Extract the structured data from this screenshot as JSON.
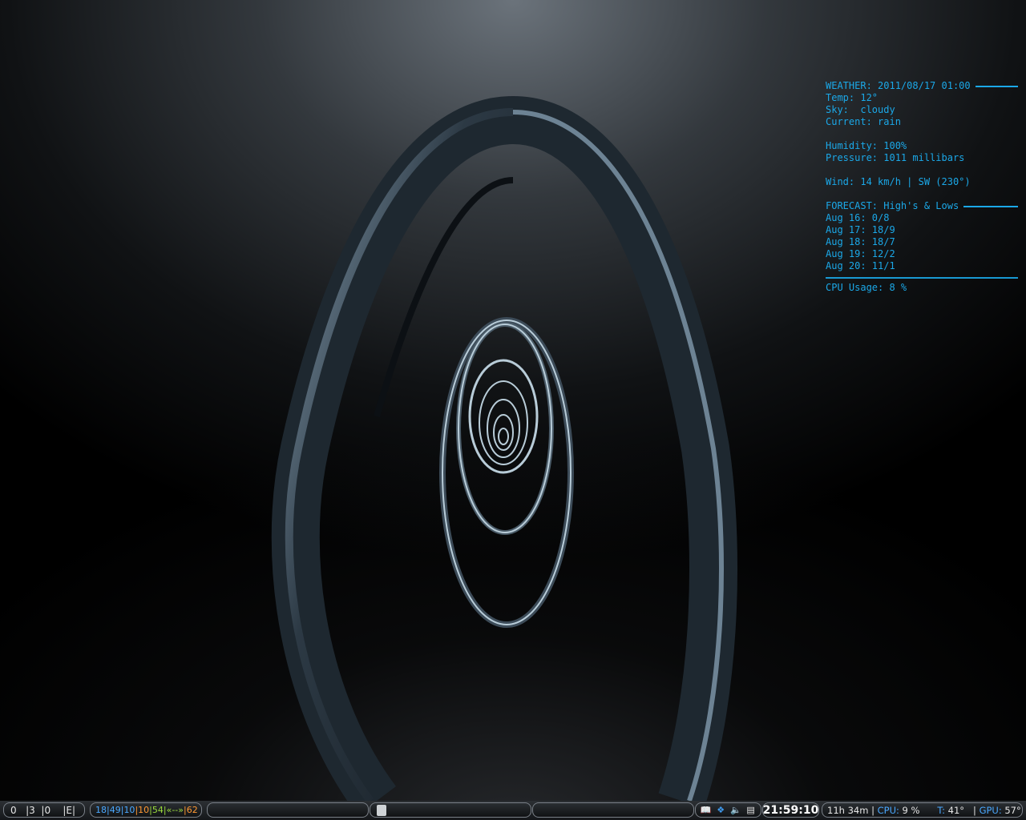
{
  "conky": {
    "weather_header": "WEATHER: 2011/08/17 01:00",
    "temp": "Temp: 12°",
    "sky": "Sky:  cloudy",
    "current": "Current: rain",
    "humidity": "Humidity: 100%",
    "pressure": "Pressure: 1011 millibars",
    "wind": "Wind: 14 km/h | SW (230°)",
    "forecast_header": "FORECAST: High's & Lows",
    "forecast": [
      "Aug 16: 0/8",
      "Aug 17: 18/9",
      "Aug 18: 18/7",
      "Aug 19: 12/2",
      "Aug 20: 11/1"
    ],
    "cpu_usage": "CPU Usage: 8 %"
  },
  "panel": {
    "workspaces": [
      "0",
      "|3",
      "|0",
      "|E|"
    ],
    "stats": {
      "v1": "18",
      "v2": "49",
      "v3": "10",
      "v4": "10",
      "v5": "54",
      "arrows": "«--»",
      "v6": "62",
      "sep": "|"
    },
    "tray_icons": [
      "book-icon",
      "dropbox-icon",
      "volume-icon",
      "printer-icon"
    ],
    "clock": "21:59:10",
    "uptime": "11h 34m",
    "cpu_label": "CPU:",
    "cpu_value": "9 %",
    "temp_label": "T:",
    "temp_value": "41°",
    "gpu_label": "GPU:",
    "gpu_value": "57°"
  },
  "colors": {
    "conky": "#1ba8e8",
    "accent_blue": "#4aa8ff",
    "accent_orange": "#ff9933",
    "accent_green": "#9bdc3c"
  }
}
